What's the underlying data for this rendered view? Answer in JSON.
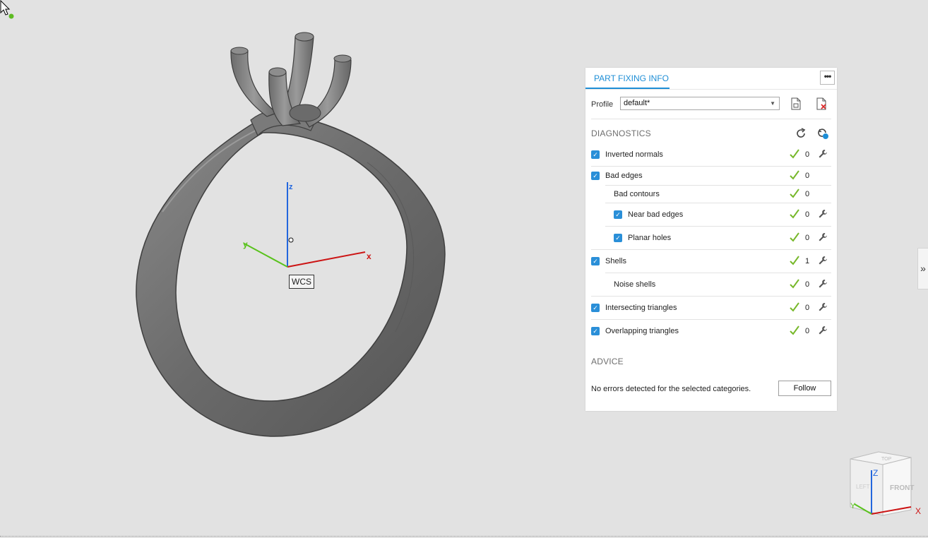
{
  "viewport": {
    "wcs_label": "WCS",
    "axis_x": "x",
    "axis_y": "y",
    "axis_z": "z"
  },
  "panel": {
    "tab_label": "PART FIXING INFO",
    "more_label": "•••",
    "profile_label": "Profile",
    "profile_value": "default*",
    "diagnostics_title": "DIAGNOSTICS",
    "rows": [
      {
        "label": "Inverted normals",
        "count": "0"
      },
      {
        "label": "Bad edges",
        "count": "0"
      },
      {
        "label": "Bad contours",
        "count": "0"
      },
      {
        "label": "Near bad edges",
        "count": "0"
      },
      {
        "label": "Planar holes",
        "count": "0"
      },
      {
        "label": "Shells",
        "count": "1"
      },
      {
        "label": "Noise shells",
        "count": "0"
      },
      {
        "label": "Intersecting triangles",
        "count": "0"
      },
      {
        "label": "Overlapping triangles",
        "count": "0"
      }
    ],
    "advice_title": "ADVICE",
    "advice_text": "No errors detected for the selected categories.",
    "follow_label": "Follow"
  },
  "side_tab_label": "»",
  "view_cube": {
    "top": "TOP",
    "left": "LEFT",
    "front": "FRONT",
    "z": "Z",
    "x": "X",
    "y": "Y"
  },
  "colors": {
    "accent": "#1e8ed6",
    "check": "#77b82a",
    "axis_x": "#cc1414",
    "axis_y": "#59c21c",
    "axis_z": "#2266dd"
  }
}
